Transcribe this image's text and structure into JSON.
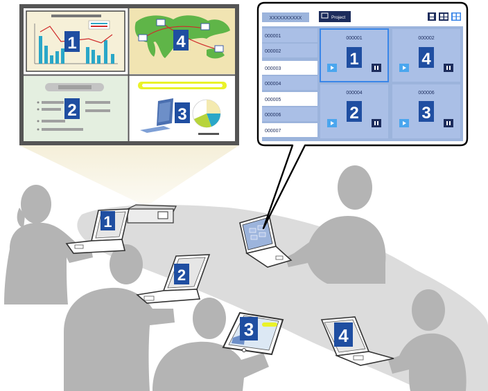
{
  "colors": {
    "badge": "#1f4ea1",
    "silhouette": "#b4b4b4",
    "table": "#dcdcdc",
    "panel_bg": "#9cb4dc",
    "tile_bg": "#aabfe6",
    "tile_selected_border": "#3a86e8",
    "play_button": "#4aa6ee",
    "pause_button": "#1c2c5c",
    "chart_panel_bg": "#f6f0d8",
    "map_panel_bg": "#f1e4b2",
    "map_land": "#5fb548",
    "text_panel_bg": "#e4efe0",
    "pie_panel_bg": "#ffffff"
  },
  "screen_panels": [
    {
      "number": "1",
      "content": "chart"
    },
    {
      "number": "4",
      "content": "map"
    },
    {
      "number": "2",
      "content": "text"
    },
    {
      "number": "3",
      "content": "computer-and-pie"
    }
  ],
  "app": {
    "header_text": "XXXXXXXXXX",
    "project_button": "Project",
    "layout_icons": [
      "single-layout-icon",
      "dual-layout-icon",
      "quad-layout-icon"
    ],
    "list_items": [
      "000001",
      "000002",
      "000003",
      "000004",
      "000005",
      "000006",
      "000007"
    ],
    "tiles": [
      {
        "id": "000001",
        "number": "1",
        "selected": true
      },
      {
        "id": "000002",
        "number": "4",
        "selected": false
      },
      {
        "id": "000004",
        "number": "2",
        "selected": false
      },
      {
        "id": "000006",
        "number": "3",
        "selected": false
      }
    ]
  },
  "device_badges": [
    "1",
    "2",
    "3",
    "4"
  ]
}
